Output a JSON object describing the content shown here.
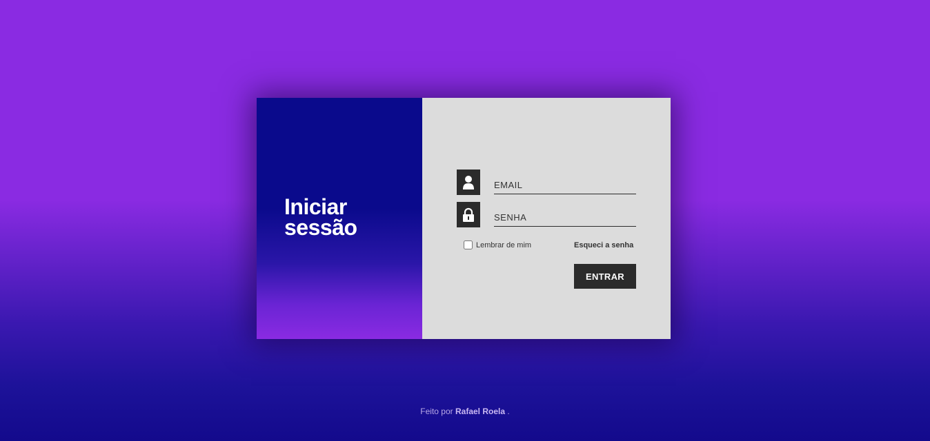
{
  "login": {
    "heading_line1": "Iniciar",
    "heading_line2": "sessão",
    "email_placeholder": "EMAIL",
    "password_placeholder": "SENHA",
    "remember_label": "Lembrar de mim",
    "remember_checked": false,
    "forgot_label": "Esqueci a senha",
    "submit_label": "ENTRAR"
  },
  "footer": {
    "prefix": "Feito por",
    "author": "Rafael Roela",
    "suffix": "."
  },
  "icons": {
    "email": "user-icon",
    "password": "lock-icon"
  },
  "colors": {
    "background_top": "#8a2be2",
    "background_bottom": "#130a8c",
    "left_panel": "#0a0a8c",
    "form_panel": "#dcdcdc",
    "dark": "#2b2b2b"
  }
}
